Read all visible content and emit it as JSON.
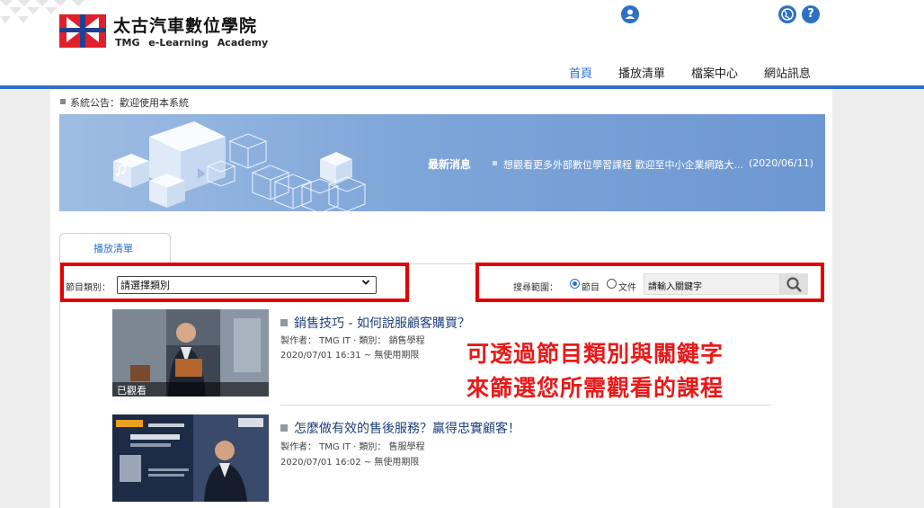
{
  "header": {
    "brand_zh": "太古汽車數位學院",
    "brand_en": "TMG e-Learning Academy",
    "icons": [
      "user-icon",
      "globe-icon",
      "help-icon"
    ],
    "nav": [
      "首頁",
      "播放清單",
      "檔案中心",
      "網站訊息"
    ],
    "active_nav": "首頁"
  },
  "notice": "系統公告：歡迎使用本系統",
  "banner": {
    "news_label": "最新消息",
    "news_text": "想觀看更多外部數位學習課程 歡迎至中小企業網路大...",
    "news_date": "(2020/06/11)"
  },
  "tab": "播放清單",
  "filter": {
    "category_label": "節目類別：",
    "category_value": "請選擇類別",
    "scope_label": "搜尋範圍：",
    "scope_options": [
      "節目",
      "文件"
    ],
    "scope_selected": "節目",
    "keyword_placeholder": "請輸入關鍵字"
  },
  "courses": [
    {
      "title": "銷售技巧 - 如何說服顧客購買？",
      "meta": "製作者： TMG IT · 類別： 銷售學程",
      "date": "2020/07/01 16:31 ~ 無使用期限",
      "badge": "已觀看"
    },
    {
      "title": "怎麼做有效的售後服務？贏得忠實顧客！",
      "meta": "製作者： TMG IT · 類別： 售服學程",
      "date": "2020/07/01 16:02 ~ 無使用期限"
    }
  ],
  "annotation": [
    "可透過節目類別與關鍵字",
    "來篩選您所需觀看的課程"
  ],
  "colors": {
    "accent": "#2f6fc9",
    "highlight": "#e20000",
    "logo_red": "#e0202a"
  }
}
